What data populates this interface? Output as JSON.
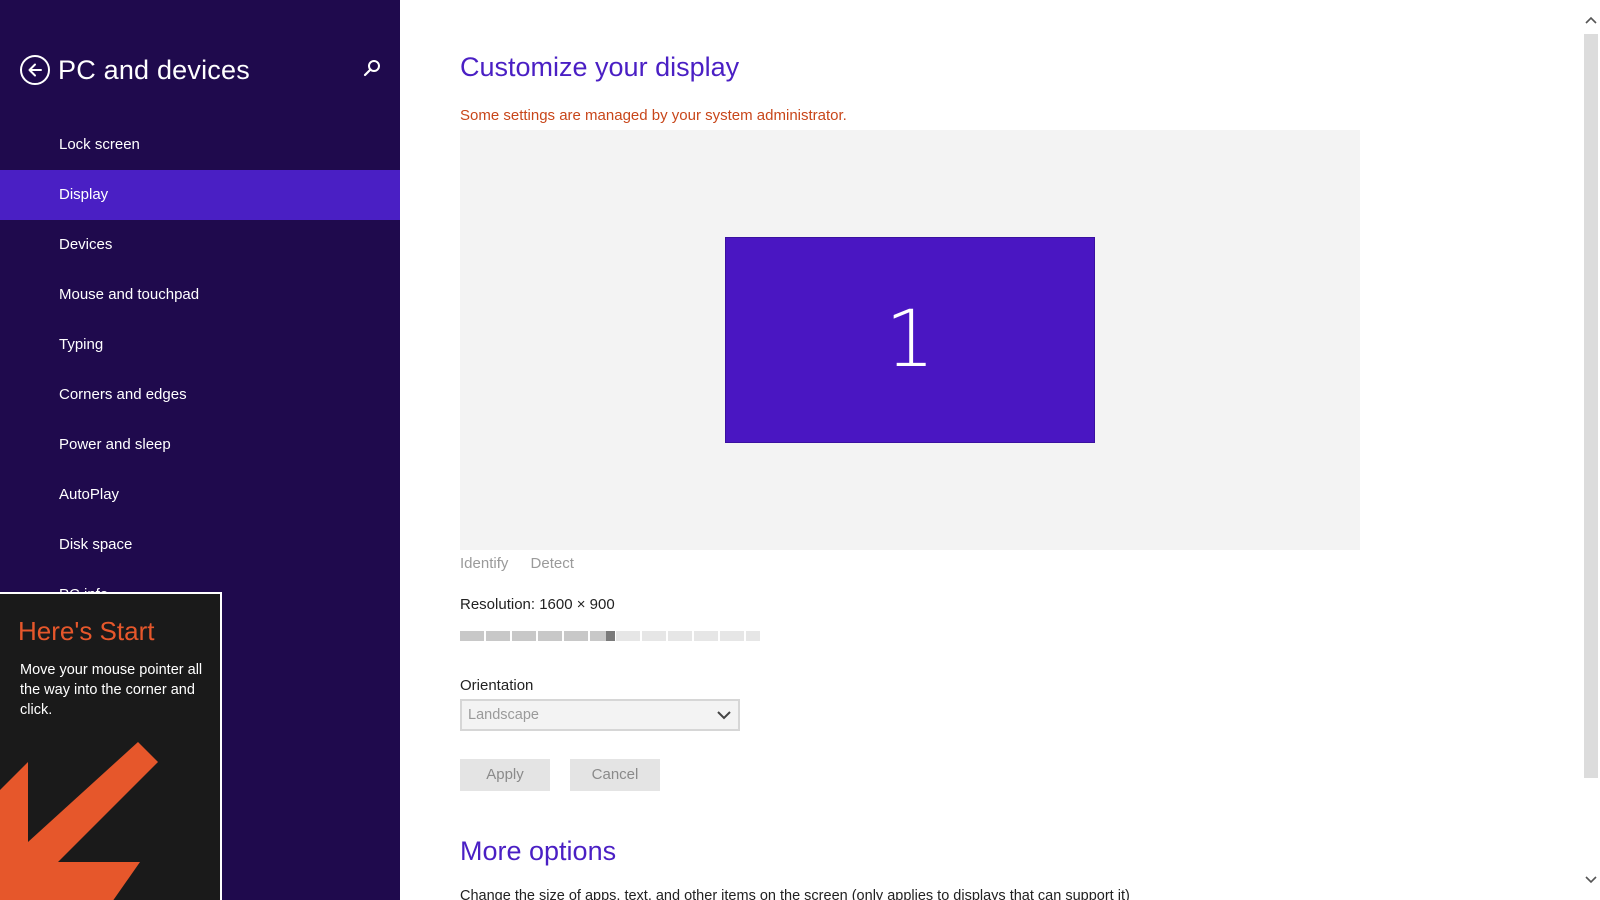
{
  "sidebar": {
    "title": "PC and devices",
    "back_icon": "back-arrow-icon",
    "search_icon": "search-icon",
    "items": [
      {
        "label": "Lock screen",
        "active": false
      },
      {
        "label": "Display",
        "active": true
      },
      {
        "label": "Devices",
        "active": false
      },
      {
        "label": "Mouse and touchpad",
        "active": false
      },
      {
        "label": "Typing",
        "active": false
      },
      {
        "label": "Corners and edges",
        "active": false
      },
      {
        "label": "Power and sleep",
        "active": false
      },
      {
        "label": "AutoPlay",
        "active": false
      },
      {
        "label": "Disk space",
        "active": false
      },
      {
        "label": "PC info",
        "active": false
      }
    ]
  },
  "start_tip": {
    "title": "Here's Start",
    "body": "Move your mouse pointer all the way into the corner and click.",
    "arrow_icon": "diagonal-arrow-icon"
  },
  "main": {
    "title": "Customize your display",
    "admin_notice": "Some settings are managed by your system administrator.",
    "monitor_number": "1",
    "links": {
      "identify": "Identify",
      "detect": "Detect"
    },
    "resolution_label": "Resolution: 1600 × 900",
    "resolution_slider": {
      "steps": 12,
      "position": 6
    },
    "orientation_label": "Orientation",
    "orientation_value": "Landscape",
    "apply_label": "Apply",
    "cancel_label": "Cancel",
    "more_options_title": "More options",
    "more_options_desc": "Change the size of apps, text, and other items on the screen (only applies to displays that can support it)"
  },
  "colors": {
    "sidebar_bg": "#1f0a4d",
    "accent": "#4a1fc4",
    "monitor": "#4a16c2",
    "notice": "#c8461a",
    "tip_title": "#e6572b"
  }
}
